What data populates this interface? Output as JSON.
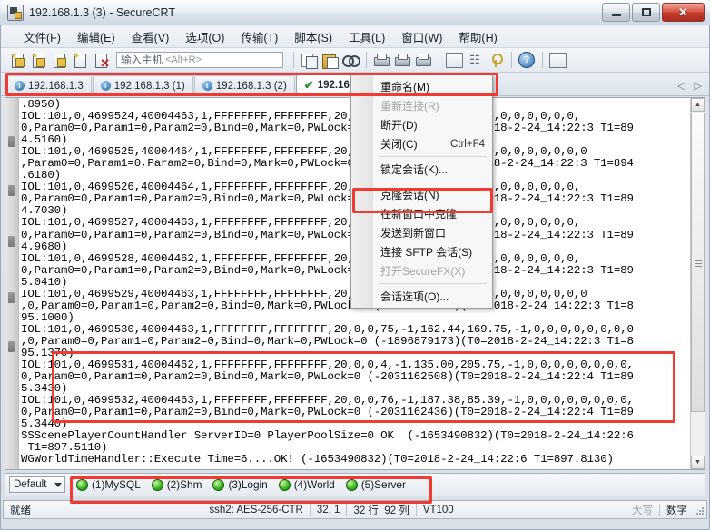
{
  "window": {
    "title": "192.168.1.3 (3) - SecureCRT",
    "app_icon": "securecrt-icon",
    "minimize_label": "–",
    "maximize_label": "□",
    "close_label": "✕"
  },
  "menubar": {
    "items": [
      {
        "name": "menu-file",
        "label": "文件(F)"
      },
      {
        "name": "menu-edit",
        "label": "编辑(E)"
      },
      {
        "name": "menu-view",
        "label": "查看(V)"
      },
      {
        "name": "menu-options",
        "label": "选项(O)"
      },
      {
        "name": "menu-transfer",
        "label": "传输(T)"
      },
      {
        "name": "menu-script",
        "label": "脚本(S)"
      },
      {
        "name": "menu-tools",
        "label": "工具(L)"
      },
      {
        "name": "menu-window",
        "label": "窗口(W)"
      },
      {
        "name": "menu-help",
        "label": "帮助(H)"
      }
    ]
  },
  "toolbar": {
    "host_input": {
      "value": "",
      "placeholder_zh": "输入主机",
      "placeholder_accel": "<Alt+R>"
    },
    "icons": [
      "new-session-icon",
      "new-session-wizard-icon",
      "clone-session-icon",
      "reconnect-icon",
      "disconnect-icon",
      "copy-icon",
      "paste-icon",
      "find-icon",
      "print-icon",
      "log-session-icon",
      "print-screen-icon",
      "session-options-icon",
      "chain-icon",
      "key-icon",
      "help-icon",
      "arrange-icon"
    ],
    "help_glyph": "?"
  },
  "tabs": {
    "items": [
      {
        "label": "192.168.1.3",
        "icon": "info-icon",
        "active": false
      },
      {
        "label": "192.168.1.3 (1)",
        "icon": "info-icon",
        "active": false
      },
      {
        "label": "192.168.1.3 (2)",
        "icon": "info-icon",
        "active": false
      },
      {
        "label": "192.168.1.3",
        "icon": "check-icon",
        "active": true
      }
    ],
    "nav_prev": "◁",
    "nav_next": "▷"
  },
  "context_menu": {
    "items": [
      {
        "label": "重命名(M)",
        "accel": "",
        "disabled": false,
        "separator_after": false
      },
      {
        "label": "重新连接(R)",
        "accel": "",
        "disabled": true,
        "separator_after": false
      },
      {
        "label": "断开(D)",
        "accel": "",
        "disabled": false,
        "separator_after": false
      },
      {
        "label": "关闭(C)",
        "accel": "Ctrl+F4",
        "disabled": false,
        "separator_after": true
      },
      {
        "label": "锁定会话(K)...",
        "accel": "",
        "disabled": false,
        "separator_after": true
      },
      {
        "label": "克隆会话(N)",
        "accel": "",
        "disabled": false,
        "separator_after": false
      },
      {
        "label": "在新窗口中克隆",
        "accel": "",
        "disabled": false,
        "separator_after": false
      },
      {
        "label": "发送到新窗口",
        "accel": "",
        "disabled": false,
        "separator_after": false
      },
      {
        "label": "连接 SFTP 会话(S)",
        "accel": "",
        "disabled": false,
        "separator_after": false
      },
      {
        "label": "打开SecureFX(X)",
        "accel": "",
        "disabled": true,
        "separator_after": true
      },
      {
        "label": "会话选项(O)...",
        "accel": "",
        "disabled": false,
        "separator_after": false
      }
    ]
  },
  "terminal": {
    "lines": [
      ".8950)",
      "IOL:101,0,4699524,40004463,1,FFFFFFFF,FFFFFFFF,20,0,0,70,-1,198.42,-1,0,0,0,0,0,0,0,",
      "0,Param0=0,Param1=0,Param2=0,Bind=0,Mark=0,PWLock=0 (-2031162776)(T0=2018-2-24_14:22:3 T1=89",
      "4.5160)",
      "IOL:101,0,4699525,40004464,1,FFFFFFFF,FFFFFFFF,20,0,0,71,-1,216.31,-1,0,0,0,0,0,0,0,0",
      ",Param0=0,Param1=0,Param2=0,Bind=0,Mark=0,PWLock=0 (-2031162704)(T0=2018-2-24_14:22:3 T1=894",
      ".6180)",
      "IOL:101,0,4699526,40004464,1,FFFFFFFF,FFFFFFFF,20,0,0,72,-1,280.64,-1,0,0,0,0,0,0,0,",
      "0,Param0=0,Param1=0,Param2=0,Bind=0,Mark=0,PWLock=0 (-2031162632)(T0=2018-2-24_14:22:3 T1=89",
      "4.7030)",
      "IOL:101,0,4699527,40004463,1,FFFFFFFF,FFFFFFFF,20,0,0,73,-1,223.29,-1,0,0,0,0,0,0,0,",
      "0,Param0=0,Param1=0,Param2=0,Bind=0,Mark=0,PWLock=0 (-2031162560)(T0=2018-2-24_14:22:3 T1=89",
      "4.9680)",
      "IOL:101,0,4699528,40004462,1,FFFFFFFF,FFFFFFFF,20,0,0,74,-1,265.46,-1,0,0,0,0,0,0,0,",
      "0,Param0=0,Param1=0,Param2=0,Bind=0,Mark=0,PWLock=0 (-2031162488)(T0=2018-2-24_14:22:3 T1=89",
      "5.0410)",
      "IOL:101,0,4699529,40004463,1,FFFFFFFF,FFFFFFFF,20,0,0,74,-1,244.90,-1,0,0,0,0,0,0,0,0",
      ",0,Param0=0,Param1=0,Param2=0,Bind=0,Mark=0,PWLock=0 (-1896879245)(T0=2018-2-24_14:22:3 T1=8",
      "95.1000)",
      "IOL:101,0,4699530,40004463,1,FFFFFFFF,FFFFFFFF,20,0,0,75,-1,162.44,169.75,-1,0,0,0,0,0,0,0,0",
      ",0,Param0=0,Param1=0,Param2=0,Bind=0,Mark=0,PWLock=0 (-1896879173)(T0=2018-2-24_14:22:3 T1=8",
      "95.1370)",
      "IOL:101,0,4699531,40004462,1,FFFFFFFF,FFFFFFFF,20,0,0,4,-1,135.00,205.75,-1,0,0,0,0,0,0,0,0,",
      "0,Param0=0,Param1=0,Param2=0,Bind=0,Mark=0,PWLock=0 (-2031162508)(T0=2018-2-24_14:22:4 T1=89",
      "5.3430)",
      "IOL:101,0,4699532,40004463,1,FFFFFFFF,FFFFFFFF,20,0,0,76,-1,187.38,85.39,-1,0,0,0,0,0,0,0,0,",
      "0,Param0=0,Param1=0,Param2=0,Bind=0,Mark=0,PWLock=0 (-2031162436)(T0=2018-2-24_14:22:4 T1=89",
      "5.3440)",
      "SSScenePlayerCountHandler ServerID=0 PlayerPoolSize=0 OK  (-1653490832)(T0=2018-2-24_14:22:6",
      " T1=897.5110)",
      "WGWorldTimeHandler::Execute Time=6....OK! (-1653490832)(T0=2018-2-24_14:22:6 T1=897.8130)"
    ]
  },
  "buttonbar": {
    "session_select": "Default",
    "buttons": [
      {
        "label": "(1)MySQL",
        "led": "#3fb81f"
      },
      {
        "label": "(2)Shm",
        "led": "#3fb81f"
      },
      {
        "label": "(3)Login",
        "led": "#3fb81f"
      },
      {
        "label": "(4)World",
        "led": "#3fb81f"
      },
      {
        "label": "(5)Server",
        "led": "#3fb81f"
      }
    ]
  },
  "statusbar": {
    "ready": "就绪",
    "cipher": "ssh2: AES-256-CTR",
    "cursor": "32, 1",
    "size": "32 行, 92 列",
    "emulation": "VT100",
    "caps": "大写",
    "num": "数字"
  },
  "annotations": {
    "accent_color": "#ef3b33",
    "boxes": [
      {
        "name": "tabs-highlight"
      },
      {
        "name": "clone-session-highlight"
      },
      {
        "name": "log-lines-highlight"
      },
      {
        "name": "button-bar-highlight"
      }
    ]
  }
}
